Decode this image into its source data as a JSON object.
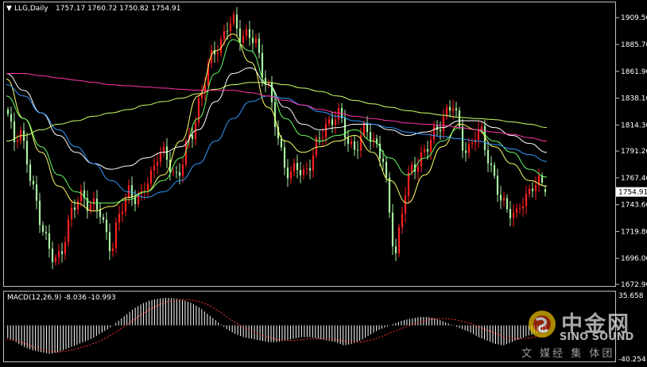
{
  "window": {
    "symbol_label": "LLG,Daily",
    "ohlc": "1757.17 1760.72 1750.82 1754.91",
    "collapse_glyph": "▼"
  },
  "colors": {
    "background": "#000000",
    "bull": "#ff2020",
    "bear": "#a8f0a0",
    "current_price_bg": "#ffffff",
    "ma_yellow": "#ffff66",
    "ma_green": "#66ff66",
    "ma_white": "#ffffff",
    "ma_cyan": "#3399ff",
    "ma_lime": "#ccff66",
    "ma_magenta": "#ff33aa",
    "macd_hist": "#ffffff",
    "macd_signal": "#ff3030"
  },
  "chart_data": [
    {
      "type": "candlestick",
      "title": "LLG,Daily",
      "ylim": [
        1672.9,
        1919.5
      ],
      "yticks": [
        1909.5,
        1885.7,
        1861.9,
        1838.1,
        1814.3,
        1791.2,
        1767.4,
        1743.6,
        1719.8,
        1696.0,
        1672.9
      ],
      "current_price": 1754.91,
      "last_bar": {
        "open": 1757.17,
        "high": 1760.72,
        "low": 1750.82,
        "close": 1754.91
      },
      "key_closes": [
        1820,
        1800,
        1815,
        1790,
        1760,
        1745,
        1725,
        1705,
        1690,
        1700,
        1720,
        1735,
        1745,
        1755,
        1745,
        1740,
        1735,
        1720,
        1705,
        1725,
        1745,
        1760,
        1750,
        1745,
        1765,
        1775,
        1790,
        1785,
        1780,
        1770,
        1775,
        1795,
        1810,
        1835,
        1850,
        1870,
        1885,
        1890,
        1900,
        1905,
        1898,
        1895,
        1890,
        1885,
        1865,
        1850,
        1820,
        1795,
        1780,
        1770,
        1775,
        1770,
        1780,
        1790,
        1800,
        1815,
        1820,
        1825,
        1810,
        1800,
        1795,
        1800,
        1810,
        1805,
        1795,
        1780,
        1735,
        1700,
        1730,
        1760,
        1775,
        1785,
        1790,
        1795,
        1810,
        1820,
        1825,
        1830,
        1815,
        1795,
        1790,
        1805,
        1810,
        1790,
        1765,
        1750,
        1745,
        1740,
        1730,
        1745,
        1755,
        1765,
        1760,
        1755
      ],
      "moving_averages": [
        {
          "color": "ma_yellow",
          "closes": [
            1855,
            1820,
            1790,
            1760,
            1745,
            1738,
            1742,
            1750,
            1755,
            1770,
            1800,
            1840,
            1880,
            1895,
            1870,
            1830,
            1800,
            1790,
            1795,
            1800,
            1805,
            1790,
            1765,
            1745,
            1770,
            1795,
            1815,
            1810,
            1795,
            1780,
            1765,
            1760
          ]
        },
        {
          "color": "ma_green",
          "closes": [
            1840,
            1820,
            1795,
            1770,
            1755,
            1745,
            1745,
            1748,
            1755,
            1765,
            1785,
            1820,
            1860,
            1890,
            1880,
            1850,
            1820,
            1805,
            1800,
            1805,
            1810,
            1800,
            1785,
            1770,
            1785,
            1800,
            1812,
            1810,
            1800,
            1790,
            1775,
            1768
          ]
        },
        {
          "color": "ma_white",
          "closes": [
            1860,
            1845,
            1825,
            1805,
            1790,
            1780,
            1775,
            1778,
            1785,
            1790,
            1795,
            1810,
            1835,
            1860,
            1865,
            1850,
            1830,
            1815,
            1810,
            1812,
            1815,
            1815,
            1810,
            1805,
            1808,
            1812,
            1818,
            1818,
            1812,
            1805,
            1798,
            1790
          ]
        },
        {
          "color": "ma_cyan",
          "closes": [
            1850,
            1840,
            1825,
            1810,
            1795,
            1780,
            1765,
            1755,
            1750,
            1755,
            1765,
            1780,
            1800,
            1820,
            1835,
            1840,
            1838,
            1832,
            1826,
            1822,
            1818,
            1815,
            1812,
            1808,
            1806,
            1804,
            1802,
            1800,
            1797,
            1793,
            1788,
            1782
          ]
        },
        {
          "color": "ma_lime",
          "closes": [
            1800,
            1805,
            1810,
            1815,
            1818,
            1822,
            1825,
            1828,
            1832,
            1835,
            1838,
            1842,
            1846,
            1850,
            1852,
            1852,
            1850,
            1847,
            1844,
            1840,
            1836,
            1833,
            1830,
            1827,
            1825,
            1823,
            1821,
            1820,
            1819,
            1817,
            1815,
            1812
          ]
        },
        {
          "color": "ma_magenta",
          "closes": [
            1860,
            1860,
            1858,
            1856,
            1854,
            1852,
            1850,
            1849,
            1848,
            1847,
            1846,
            1845,
            1845,
            1845,
            1843,
            1840,
            1836,
            1832,
            1828,
            1825,
            1822,
            1820,
            1818,
            1816,
            1815,
            1814,
            1812,
            1810,
            1808,
            1806,
            1803,
            1800
          ]
        }
      ]
    },
    {
      "type": "bar",
      "title": "MACD(12,26,9) -8.036 -10.993",
      "label": "MACD(12,26,9)",
      "macd_value": "-8.036",
      "signal_value": "-10.993",
      "ylim": [
        -40.254,
        35.658
      ],
      "yticks": [
        35.658,
        -40.254
      ],
      "values": [
        -15,
        -20,
        -26,
        -30,
        -32,
        -34,
        -32,
        -28,
        -24,
        -20,
        -16,
        -10,
        -4,
        4,
        12,
        20,
        26,
        30,
        32,
        33,
        32,
        30,
        26,
        20,
        12,
        4,
        -4,
        -10,
        -14,
        -16,
        -18,
        -20,
        -20,
        -18,
        -16,
        -14,
        -14,
        -16,
        -18,
        -20,
        -24,
        -22,
        -18,
        -12,
        -6,
        -2,
        2,
        6,
        8,
        10,
        10,
        8,
        4,
        0,
        -4,
        -8,
        -14,
        -18,
        -22,
        -24,
        -20,
        -16,
        -12,
        -9,
        -8
      ],
      "signal": [
        -16,
        -18,
        -21,
        -25,
        -28,
        -31,
        -32,
        -31,
        -29,
        -26,
        -23,
        -19,
        -14,
        -8,
        -1,
        6,
        13,
        19,
        24,
        28,
        30,
        31,
        30,
        28,
        24,
        18,
        11,
        4,
        -2,
        -7,
        -11,
        -14,
        -17,
        -18,
        -18,
        -17,
        -16,
        -16,
        -16,
        -17,
        -19,
        -20,
        -20,
        -18,
        -15,
        -11,
        -7,
        -3,
        1,
        4,
        7,
        8,
        8,
        7,
        5,
        2,
        -2,
        -6,
        -10,
        -14,
        -16,
        -16,
        -15,
        -13,
        -11
      ]
    }
  ],
  "watermark": {
    "cn_name": "中金网",
    "en_name": "SINO SOUND",
    "sub_text": "文 媒经 集 体团"
  }
}
